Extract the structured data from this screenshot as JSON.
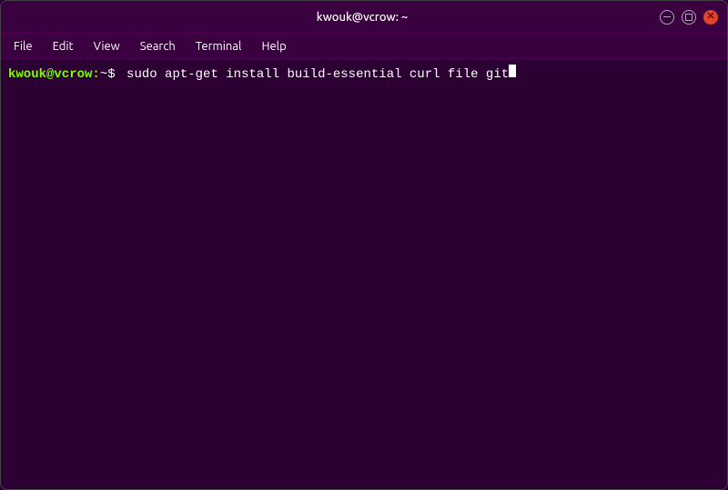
{
  "window": {
    "title": "kwouk@vcrow: ~",
    "colors": {
      "background": "#2d0033",
      "titlebar": "#3a0040",
      "menubar": "#3a0040",
      "prompt_user": "#7dff00",
      "prompt_text": "#ffffff",
      "close_btn": "#e0442a"
    }
  },
  "titlebar": {
    "title": "kwouk@vcrow: ~"
  },
  "menubar": {
    "items": [
      {
        "label": "File"
      },
      {
        "label": "Edit"
      },
      {
        "label": "View"
      },
      {
        "label": "Search"
      },
      {
        "label": "Terminal"
      },
      {
        "label": "Help"
      }
    ]
  },
  "terminal": {
    "prompt_user": "kwouk@vcrow:",
    "prompt_dir": "~",
    "prompt_symbol": "$",
    "command": "sudo apt-get install build-essential curl file git"
  }
}
